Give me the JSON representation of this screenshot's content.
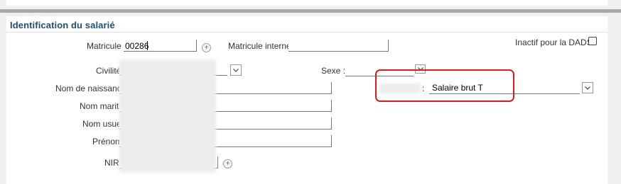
{
  "section": {
    "title": "Identification du salarié"
  },
  "form": {
    "matricule": {
      "label": "Matricule :",
      "value": "00286"
    },
    "matricule_interne": {
      "label": "Matricule interne:",
      "value": ""
    },
    "inactif_dads": {
      "label": "Inactif pour la DADS",
      "checked": false
    },
    "civilite": {
      "label": "Civilité"
    },
    "sexe": {
      "label": "Sexe :"
    },
    "nom_naissance": {
      "label": "Nom de naissance"
    },
    "nom_marital": {
      "label": "Nom marital"
    },
    "nom_usuel": {
      "label": "Nom usuel"
    },
    "prenom": {
      "label": "Prénom"
    },
    "nir": {
      "label": "NIR"
    },
    "custom_field": {
      "separator": ":",
      "value": "Salaire brut T"
    }
  },
  "icons": {
    "plus": "+",
    "chevron": "chevron-down-icon"
  },
  "colors": {
    "title": "#1f4e79",
    "highlight": "#e0191b"
  }
}
